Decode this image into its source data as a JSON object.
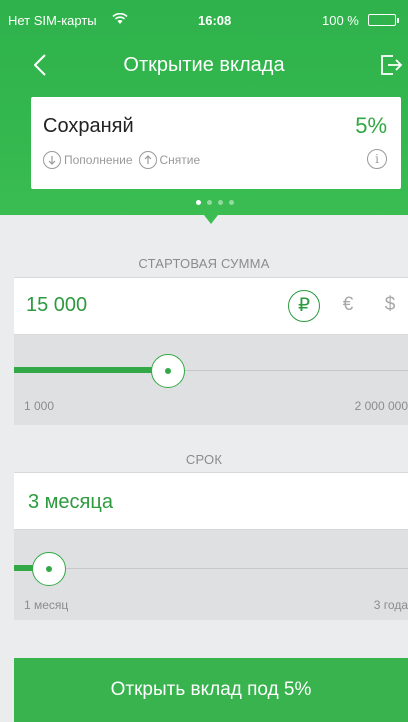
{
  "status_bar": {
    "carrier": "Нет SIM-карты",
    "time": "16:08",
    "battery": "100 %"
  },
  "navbar": {
    "title": "Открытие вклада",
    "back_icon": "chevron-left-icon",
    "exit_icon": "logout-icon"
  },
  "deposit_card": {
    "name": "Сохраняй",
    "rate": "5%",
    "topup_label": "Пополнение",
    "withdraw_label": "Снятие",
    "info_glyph": "i"
  },
  "carousel": {
    "count": 4,
    "active": 0
  },
  "amount": {
    "section_label": "СТАРТОВАЯ СУММА",
    "value": "15 000",
    "currencies": [
      "₽",
      "€",
      "$"
    ],
    "selected_currency": "₽",
    "min_label": "1 000",
    "max_label": "2 000 000",
    "slider_position": 0.39
  },
  "term": {
    "section_label": "СРОК",
    "value": "3 месяца",
    "min_label": "1 месяц",
    "max_label": "3 года",
    "slider_position": 0.09
  },
  "cta": {
    "label": "Открыть вклад под 5%"
  },
  "colors": {
    "brand_green": "#33b74e",
    "accent_text": "#2d9a3f"
  }
}
